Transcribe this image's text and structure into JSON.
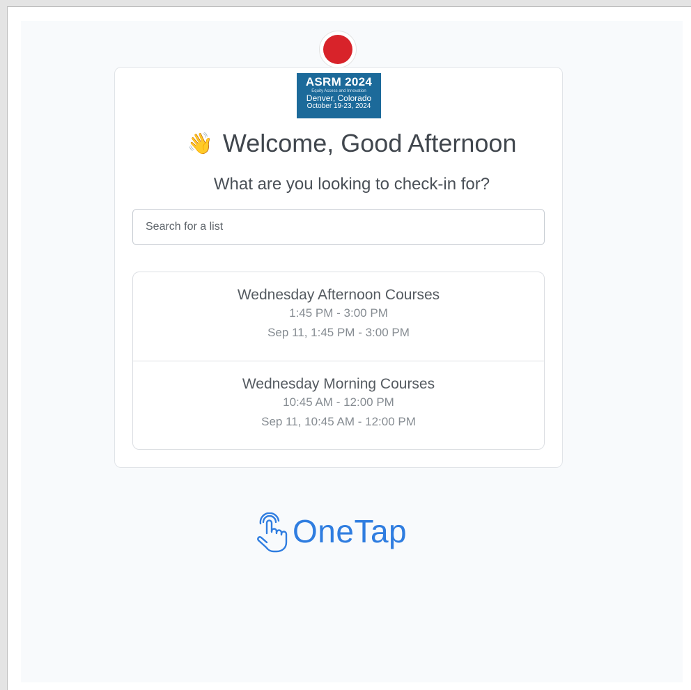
{
  "brand": {
    "event_logo": {
      "title": "ASRM 2024",
      "tagline": "Equity Access and Innovation",
      "location": "Denver, Colorado",
      "dates": "October 19-23, 2024"
    },
    "footer_logo_text": "OneTap",
    "primary_color": "#2f7de0"
  },
  "header": {
    "welcome_emoji": "👋",
    "welcome": "Welcome, Good Afternoon",
    "subtitle": "What are you looking to check-in for?"
  },
  "search": {
    "placeholder": "Search for a list",
    "value": ""
  },
  "lists": [
    {
      "title": "Wednesday Afternoon Courses",
      "time": "1:45 PM - 3:00 PM",
      "date": "Sep 11, 1:45 PM - 3:00 PM"
    },
    {
      "title": "Wednesday Morning Courses",
      "time": "10:45 AM - 12:00 PM",
      "date": "Sep 11, 10:45 AM - 12:00 PM"
    }
  ]
}
